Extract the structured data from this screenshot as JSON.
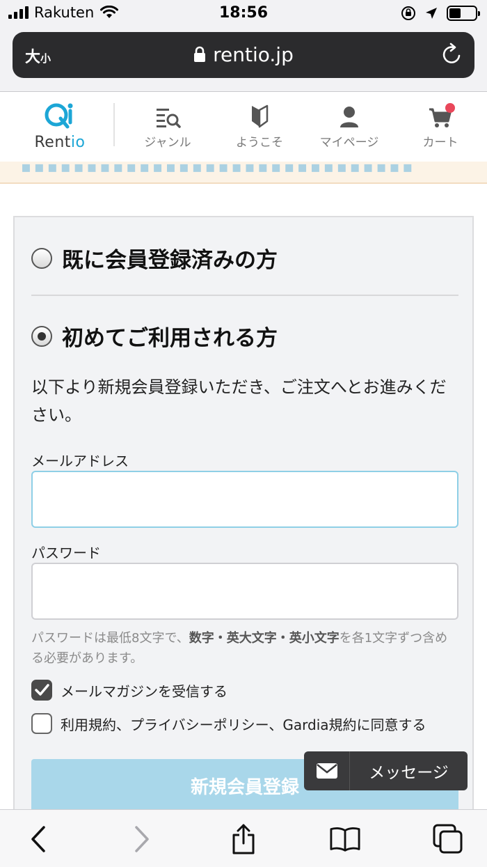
{
  "status_bar": {
    "carrier": "Rakuten",
    "time": "18:56"
  },
  "browser": {
    "text_size_label": "大",
    "text_size_small": "小",
    "url": "rentio.jp"
  },
  "site_header": {
    "logo_text_prefix": "Rent",
    "logo_text_suffix": "io",
    "nav": [
      {
        "label": "ジャンル",
        "icon": "genre-search-icon"
      },
      {
        "label": "ようこそ",
        "icon": "beginner-mark-icon"
      },
      {
        "label": "マイページ",
        "icon": "person-icon"
      },
      {
        "label": "カート",
        "icon": "cart-icon",
        "badge": true
      }
    ]
  },
  "colors": {
    "brand": "#1ca6d6",
    "cart_badge": "#e9475a",
    "submit_bg": "#a9d7ea",
    "panel_bg": "#f2f3f5"
  },
  "login": {
    "existing_member_label": "既に会員登録済みの方",
    "new_member_label": "初めてご利用される方",
    "selected_option": "new_member",
    "intro_text": "以下より新規会員登録いただき、ご注文へとお進みください。",
    "email_label": "メールアドレス",
    "email_value": "",
    "password_label": "パスワード",
    "password_value": "",
    "password_hint_prefix": "パスワードは最低8文字で、",
    "password_hint_bold": "数字・英大文字・英小文字",
    "password_hint_suffix": "を各1文字ずつ含める必要があります。",
    "newsletter_label": "メールマガジンを受信する",
    "newsletter_checked": true,
    "terms_label": "利用規約、プライバシーポリシー、Gardia規約に同意する",
    "terms_checked": false,
    "submit_label": "新規会員登録"
  },
  "message_button": {
    "label": "メッセージ",
    "icon": "envelope-icon"
  },
  "toolbar": {
    "items": [
      "back-icon",
      "forward-icon",
      "share-icon",
      "bookmarks-icon",
      "tabs-icon"
    ]
  }
}
